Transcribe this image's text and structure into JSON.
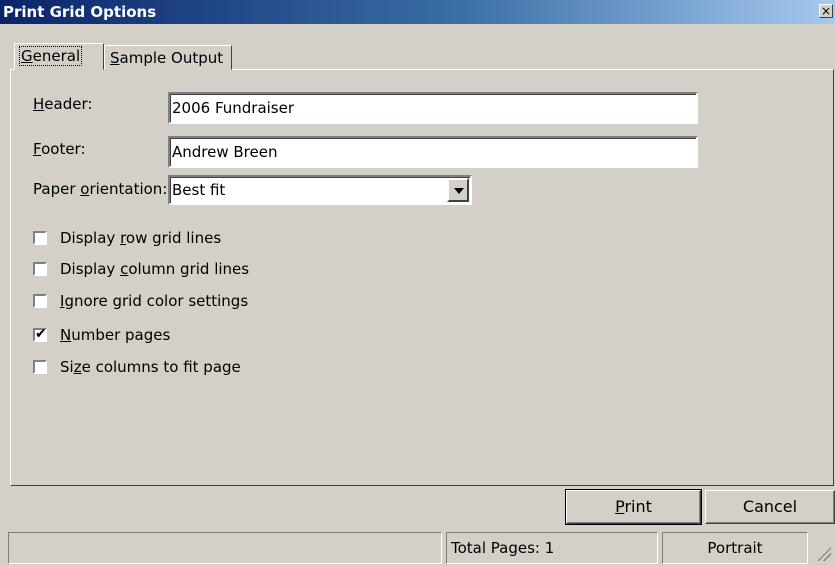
{
  "window": {
    "title": "Print Grid Options",
    "close_glyph": "×"
  },
  "tabs": [
    {
      "label": "General",
      "mnemonic": "G",
      "active": true
    },
    {
      "label": "Sample Output",
      "mnemonic": "S",
      "active": false
    }
  ],
  "form": {
    "header_label": "Header:",
    "header_value": "2006 Fundraiser",
    "footer_label": "Footer:",
    "footer_value": "Andrew Breen",
    "orientation_label": "Paper orientation:",
    "orientation_value": "Best fit"
  },
  "checkboxes": [
    {
      "label": "Display row grid lines",
      "checked": false
    },
    {
      "label": "Display column grid lines",
      "checked": false
    },
    {
      "label": "Ignore grid color settings",
      "checked": false
    },
    {
      "label": "Number pages",
      "checked": true
    },
    {
      "label": "Size columns to fit page",
      "checked": false
    }
  ],
  "buttons": {
    "print": "Print",
    "cancel": "Cancel"
  },
  "statusbar": {
    "left": "",
    "total_pages": "Total Pages: 1",
    "orientation": "Portrait"
  }
}
